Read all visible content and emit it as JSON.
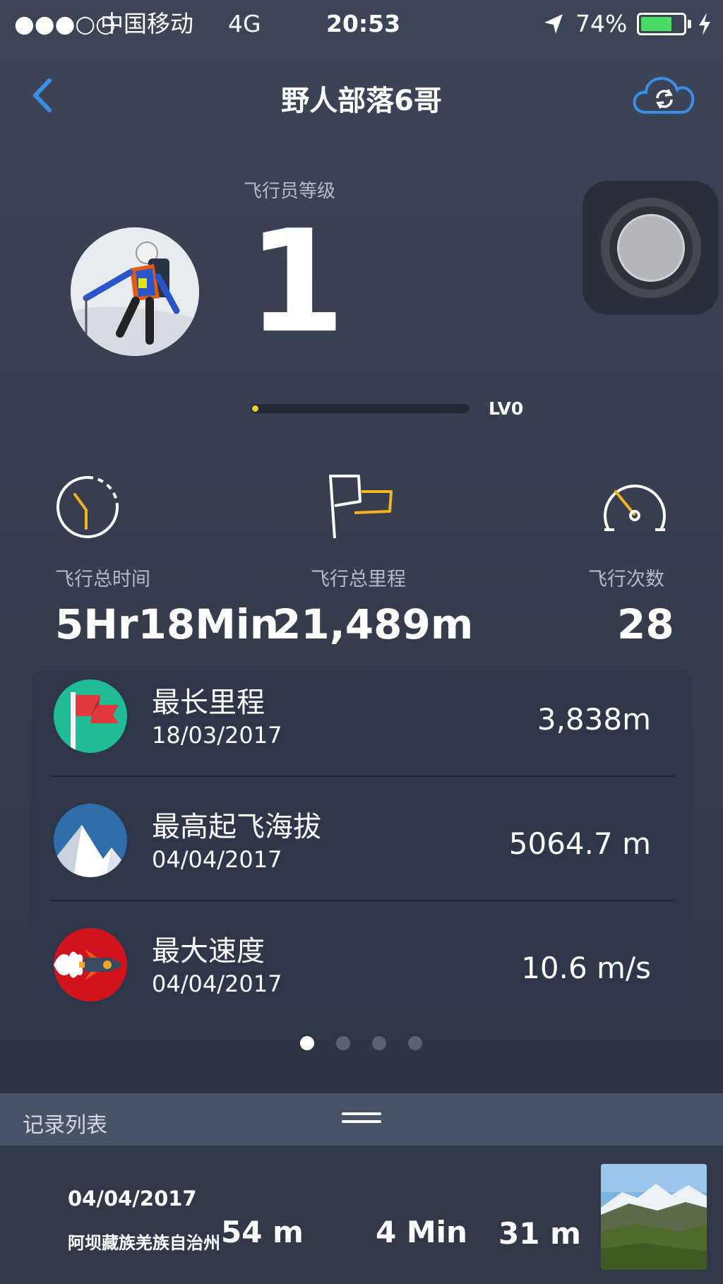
{
  "status_bar": {
    "signal": "●●●○○",
    "carrier": "中国移动",
    "network": "4G",
    "time": "20:53",
    "battery_pct": "74%",
    "battery_level": 0.74
  },
  "nav": {
    "title": "野人部落6哥",
    "back_icon": "chevron-left-icon",
    "sync_icon": "cloud-sync-icon"
  },
  "pilot": {
    "level_label": "飞行员等级",
    "level": "1",
    "progress_label": "LV0",
    "progress": 0.02
  },
  "stats": [
    {
      "icon": "timer-icon",
      "label": "飞行总时间",
      "value": "5Hr18Min"
    },
    {
      "icon": "flag-icon",
      "label": "飞行总里程",
      "value": "21,489m"
    },
    {
      "icon": "speedometer-icon",
      "label": "飞行次数",
      "value": "28"
    }
  ],
  "records": [
    {
      "icon": "red-flag-icon",
      "title": "最长里程",
      "date": "18/03/2017",
      "value": "3,838m",
      "color": "#1fbc96"
    },
    {
      "icon": "mountain-icon",
      "title": "最高起飞海拔",
      "date": "04/04/2017",
      "value": "5064.7 m",
      "color": "#2f6eaa"
    },
    {
      "icon": "rocket-icon",
      "title": "最大速度",
      "date": "04/04/2017",
      "value": "10.6 m/s",
      "color": "#d0131d"
    }
  ],
  "pager": {
    "count": 4,
    "active": 0
  },
  "record_list": {
    "title": "记录列表",
    "items": [
      {
        "date": "04/04/2017",
        "place": "阿坝藏族羌族自治州",
        "distance": "54 m",
        "duration": "4 Min",
        "altitude": "31 m"
      }
    ]
  },
  "colors": {
    "accent_blue": "#3a8ee6",
    "accent_yellow": "#f2b51d",
    "bg": "#3a4152"
  }
}
